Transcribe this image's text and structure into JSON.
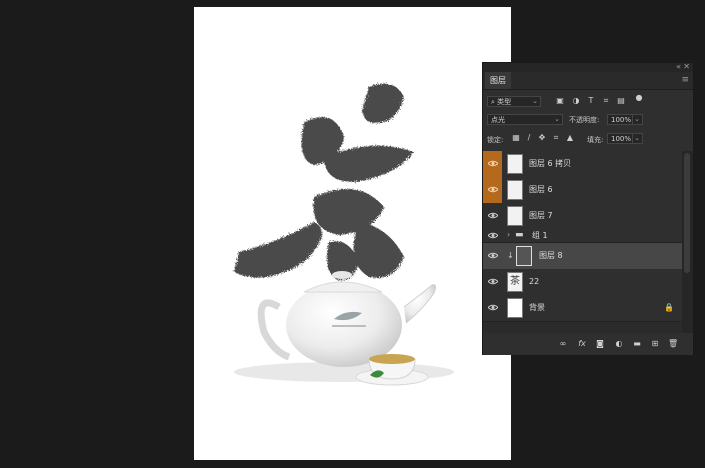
{
  "panel": {
    "tab_label": "图层",
    "window_icons": [
      "collapse-icon",
      "close-icon"
    ],
    "filter": {
      "kind_label": "类型",
      "icons": [
        "image-filter-icon",
        "adjustment-filter-icon",
        "type-filter-icon",
        "shape-filter-icon",
        "smart-object-filter-icon",
        "filter-toggle-icon"
      ]
    },
    "blend_mode": "点光",
    "opacity_label": "不透明度:",
    "opacity_value": "100%",
    "lock_label": "锁定:",
    "fill_label": "填充:",
    "fill_value": "100%"
  },
  "layers": [
    {
      "name": "图层 6 拷贝",
      "visible": true,
      "highlight": "orange"
    },
    {
      "name": "图层 6",
      "visible": true,
      "highlight": "orange"
    },
    {
      "name": "图层 7",
      "visible": true
    },
    {
      "name": "组 1",
      "visible": true,
      "type": "group"
    },
    {
      "name": "图层 8",
      "visible": true,
      "selected": true,
      "clipped": true
    },
    {
      "name": "22",
      "visible": true,
      "thumb_glyph": "茶"
    },
    {
      "name": "背景",
      "visible": true,
      "locked": true
    }
  ],
  "canvas": {
    "calligraphy_glyph": "茶"
  },
  "bottom_icons": [
    "link-layers-icon",
    "fx-icon",
    "add-mask-icon",
    "adjustment-layer-icon",
    "new-group-icon",
    "new-layer-icon",
    "delete-layer-icon"
  ],
  "colors": {
    "highlight": "#b4691c",
    "panel": "#2f2f2f",
    "workspace": "#1b1b1b"
  }
}
